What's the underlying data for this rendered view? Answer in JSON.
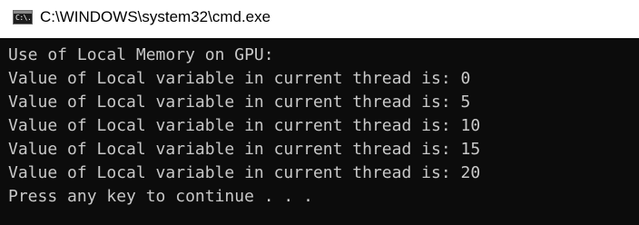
{
  "window": {
    "title": "C:\\WINDOWS\\system32\\cmd.exe",
    "icon": "cmd-console-icon",
    "icon_text": "C:\\."
  },
  "console": {
    "lines": [
      "Use of Local Memory on GPU:",
      "Value of Local variable in current thread is: 0",
      "Value of Local variable in current thread is: 5",
      "Value of Local variable in current thread is: 10",
      "Value of Local variable in current thread is: 15",
      "Value of Local variable in current thread is: 20",
      "Press any key to continue . . ."
    ],
    "background_color": "#0c0c0c",
    "text_color": "#c8c8c8"
  }
}
